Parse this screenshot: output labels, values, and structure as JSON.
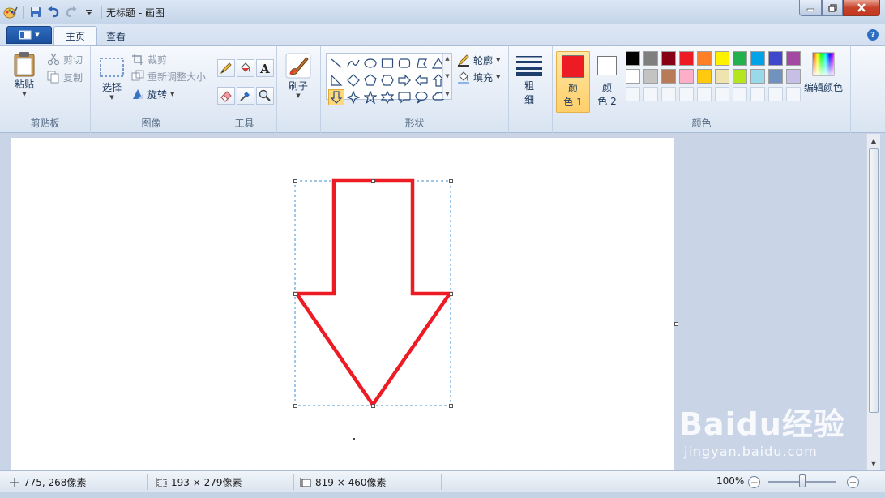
{
  "window": {
    "title": "无标题 - 画图"
  },
  "tabs": [
    {
      "label": "主页",
      "active": true
    },
    {
      "label": "查看",
      "active": false
    }
  ],
  "help": "?",
  "ribbon": {
    "clipboard": {
      "label": "剪贴板",
      "paste": "粘贴",
      "cut": "剪切",
      "copy": "复制"
    },
    "image": {
      "label": "图像",
      "select": "选择",
      "crop": "裁剪",
      "resize": "重新调整大小",
      "rotate": "旋转"
    },
    "tools": {
      "label": "工具"
    },
    "brushes": {
      "label": "刷子"
    },
    "shapes": {
      "label": "形状",
      "outline": "轮廓",
      "fill": "填充"
    },
    "size": {
      "label_line1": "粗",
      "label_line2": "细"
    },
    "colors": {
      "label": "颜色",
      "color1_line1": "颜",
      "color1_line2": "色 1",
      "color2_line1": "颜",
      "color2_line2": "色 2",
      "color1": "#ed1c24",
      "color2": "#ffffff",
      "edit": "编辑颜色",
      "palette": [
        "#000000",
        "#7f7f7f",
        "#880015",
        "#ed1c24",
        "#ff7f27",
        "#fff200",
        "#22b14c",
        "#00a2e8",
        "#3f48cc",
        "#a349a4",
        "#ffffff",
        "#c3c3c3",
        "#b97a57",
        "#ffaec9",
        "#ffc90e",
        "#efe4b0",
        "#b5e61d",
        "#99d9ea",
        "#7092be",
        "#c8bfe7"
      ]
    }
  },
  "status": {
    "cursor": "775, 268像素",
    "selection": "193 × 279像素",
    "canvas_size": "819 × 460像素",
    "zoom": "100%"
  },
  "watermark": {
    "logo": "Baidu经验",
    "url": "jingyan.baidu.com"
  },
  "drawing": {
    "stroke": "#ed1c24"
  }
}
